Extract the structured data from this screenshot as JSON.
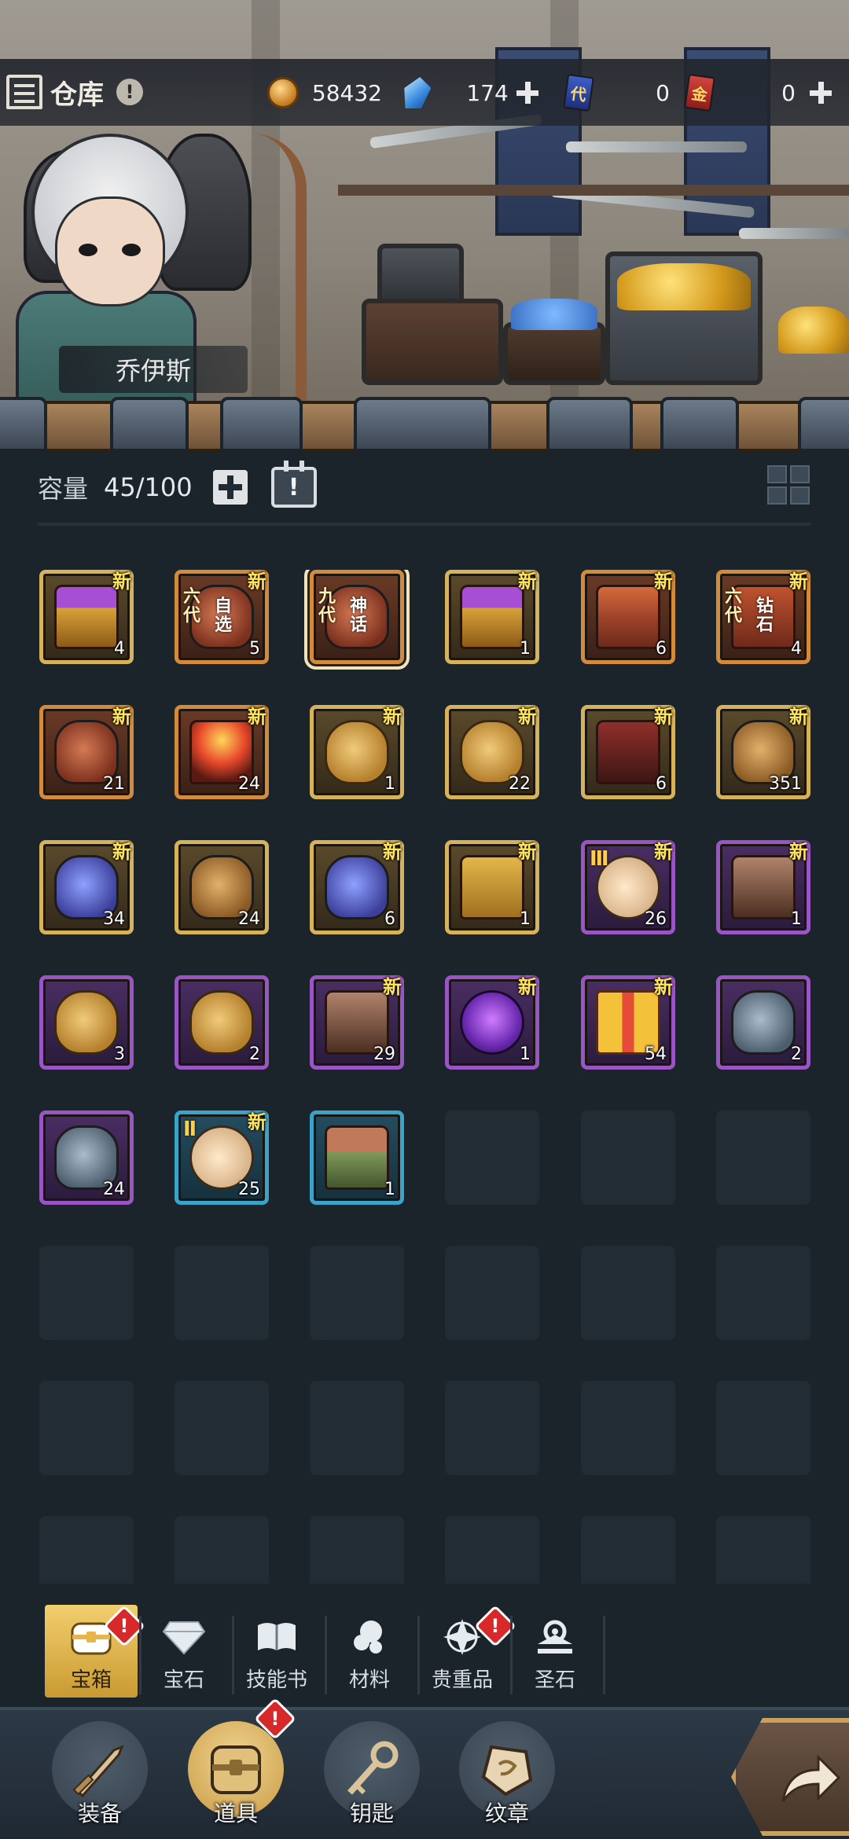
{
  "header": {
    "title": "仓库",
    "info_badge": "!",
    "hero_name": "乔伊斯"
  },
  "resources": [
    {
      "icon": "gold-coin-icon",
      "value": "58432",
      "has_plus": false
    },
    {
      "icon": "blue-crystal-icon",
      "value": "174",
      "has_plus": true
    },
    {
      "icon": "blue-ticket-icon",
      "label": "代",
      "value": "0",
      "has_plus": false
    },
    {
      "icon": "red-ticket-icon",
      "label": "金",
      "value": "0",
      "has_plus": true
    }
  ],
  "capacity": {
    "label": "容量",
    "count": "45/100",
    "calendar_badge": "!"
  },
  "items": [
    {
      "art": "gold-chest",
      "rarity": "gold",
      "qty": "4",
      "new": "新"
    },
    {
      "art": "red-vase",
      "rarity": "orange",
      "qty": "5",
      "new": "新",
      "gen": "六代",
      "gen2": "自选"
    },
    {
      "art": "red-vase",
      "rarity": "orange",
      "qty": "",
      "new": "",
      "gen": "九代",
      "gen2": "神话",
      "selected": true
    },
    {
      "art": "gold-chest",
      "rarity": "gold",
      "qty": "1",
      "new": "新"
    },
    {
      "art": "red-chest",
      "rarity": "orange",
      "qty": "6",
      "new": "新"
    },
    {
      "art": "gem-chest",
      "rarity": "orange",
      "qty": "4",
      "new": "新",
      "gen": "六代",
      "gen2": "钻石"
    },
    {
      "art": "red-vase",
      "rarity": "orange",
      "qty": "21",
      "new": "新"
    },
    {
      "art": "fire-chest",
      "rarity": "orange",
      "qty": "24",
      "new": "新"
    },
    {
      "art": "gold-bag",
      "rarity": "gold",
      "qty": "1",
      "new": "新"
    },
    {
      "art": "gold-bag",
      "rarity": "gold",
      "qty": "22",
      "new": "新"
    },
    {
      "art": "red-crown-chest",
      "rarity": "gold",
      "qty": "6",
      "new": "新"
    },
    {
      "art": "bronze-vase",
      "rarity": "gold",
      "qty": "351",
      "new": "新"
    },
    {
      "art": "blue-vase",
      "rarity": "gold",
      "qty": "34",
      "new": "新"
    },
    {
      "art": "bronze-vase",
      "rarity": "gold",
      "qty": "24",
      "new": ""
    },
    {
      "art": "blue-vase",
      "rarity": "gold",
      "qty": "6",
      "new": "新"
    },
    {
      "art": "gold-chest-closed",
      "rarity": "gold",
      "qty": "1",
      "new": "新"
    },
    {
      "art": "egg-iii",
      "rarity": "purple",
      "qty": "26",
      "new": "新",
      "tier": "Ⅲ"
    },
    {
      "art": "paw-chest",
      "rarity": "purple",
      "qty": "1",
      "new": "新"
    },
    {
      "art": "gold-bag",
      "rarity": "purple",
      "qty": "3",
      "new": ""
    },
    {
      "art": "gold-bag",
      "rarity": "purple",
      "qty": "2",
      "new": ""
    },
    {
      "art": "paw-chest",
      "rarity": "purple",
      "qty": "29",
      "new": "新"
    },
    {
      "art": "purple-orb",
      "rarity": "purple",
      "qty": "1",
      "new": "新"
    },
    {
      "art": "gift-box",
      "rarity": "purple",
      "qty": "54",
      "new": "新"
    },
    {
      "art": "steel-vase",
      "rarity": "purple",
      "qty": "2",
      "new": ""
    },
    {
      "art": "steel-vase",
      "rarity": "purple",
      "qty": "24",
      "new": ""
    },
    {
      "art": "egg-ii",
      "rarity": "blue",
      "qty": "25",
      "new": "新",
      "tier": "Ⅱ"
    },
    {
      "art": "green-chest",
      "rarity": "blue",
      "qty": "1",
      "new": ""
    }
  ],
  "categories": [
    {
      "label": "宝箱",
      "icon": "chest-icon",
      "active": true,
      "badge": "!"
    },
    {
      "label": "宝石",
      "icon": "diamond-icon",
      "active": false
    },
    {
      "label": "技能书",
      "icon": "book-icon",
      "active": false
    },
    {
      "label": "材料",
      "icon": "ore-icon",
      "active": false
    },
    {
      "label": "贵重品",
      "icon": "star-gem-icon",
      "active": false,
      "badge": "!"
    },
    {
      "label": "圣石",
      "icon": "holy-stone-icon",
      "active": false
    }
  ],
  "nav": [
    {
      "label": "装备",
      "icon": "sword-icon",
      "active": false
    },
    {
      "label": "道具",
      "icon": "chest-icon",
      "active": true,
      "badge": "!"
    },
    {
      "label": "钥匙",
      "icon": "key-icon",
      "active": false
    },
    {
      "label": "纹章",
      "icon": "emblem-icon",
      "active": false
    }
  ],
  "colors": {
    "background": "#1b232b",
    "active_tab": "#e6c06a",
    "new_tag": "#ffe45c",
    "badge_red": "#d7282a"
  }
}
